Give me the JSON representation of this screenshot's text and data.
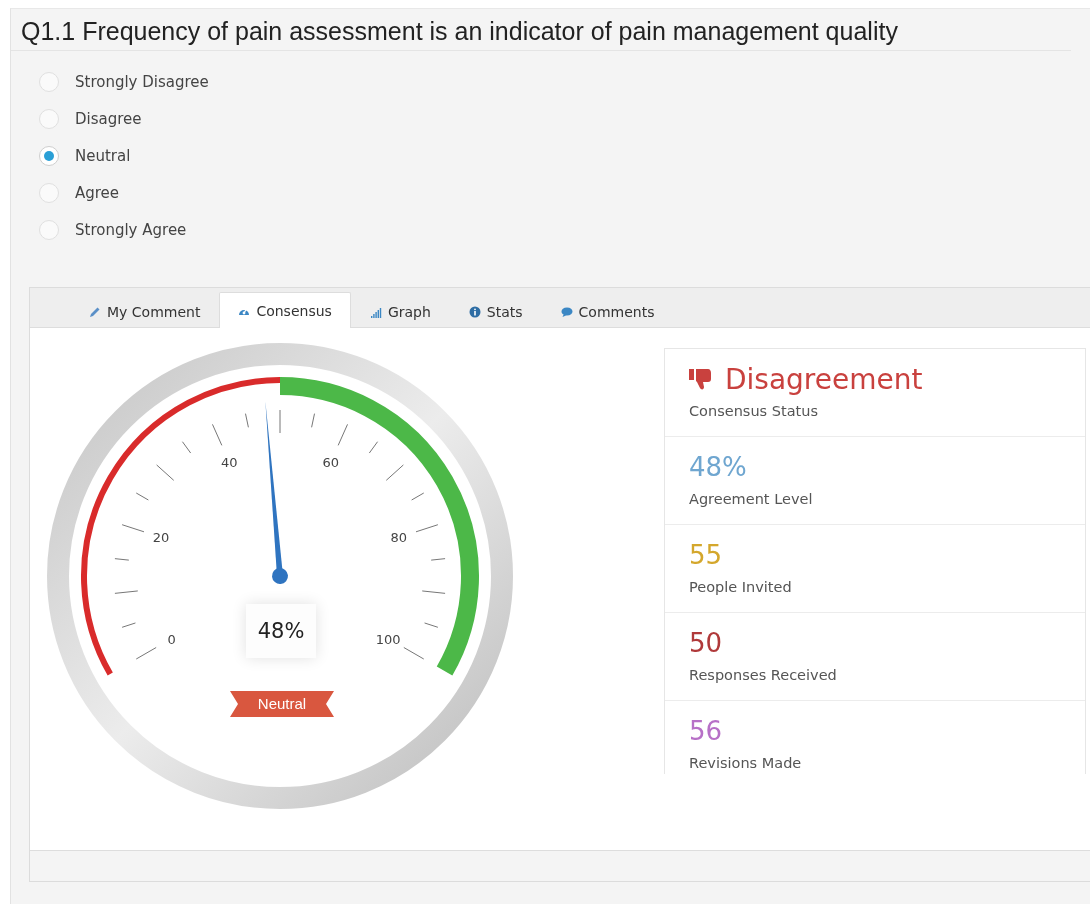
{
  "question": {
    "title": "Q1.1 Frequency of pain assessment is an indicator of pain management quality"
  },
  "options": [
    {
      "label": "Strongly Disagree",
      "selected": false
    },
    {
      "label": "Disagree",
      "selected": false
    },
    {
      "label": "Neutral",
      "selected": true
    },
    {
      "label": "Agree",
      "selected": false
    },
    {
      "label": "Strongly Agree",
      "selected": false
    }
  ],
  "tabs": [
    {
      "label": "My Comment",
      "selected": false
    },
    {
      "label": "Consensus",
      "selected": true
    },
    {
      "label": "Graph",
      "selected": false
    },
    {
      "label": "Stats",
      "selected": false
    },
    {
      "label": "Comments",
      "selected": false
    }
  ],
  "gauge": {
    "tick_labels": [
      "0",
      "20",
      "40",
      "60",
      "80",
      "100"
    ],
    "level": 0.48,
    "reading": "48%",
    "label": "Neutral",
    "zones": [
      {
        "color": "#d92b2b"
      },
      {
        "color": "#4cb848"
      }
    ]
  },
  "stats": [
    {
      "kind": "status",
      "value": "Disagreement",
      "label": "Consensus Status",
      "color": "#c9413e"
    },
    {
      "kind": "count",
      "value": "48%",
      "label": "Agreement Level",
      "color": "#6fa6d0"
    },
    {
      "kind": "count",
      "value": "55",
      "label": "People Invited",
      "color": "#d4a72c"
    },
    {
      "kind": "count",
      "value": "50",
      "label": "Responses Received",
      "color": "#b0393a"
    },
    {
      "kind": "count",
      "value": "56",
      "label": "Revisions Made",
      "color": "#b770c7"
    }
  ]
}
